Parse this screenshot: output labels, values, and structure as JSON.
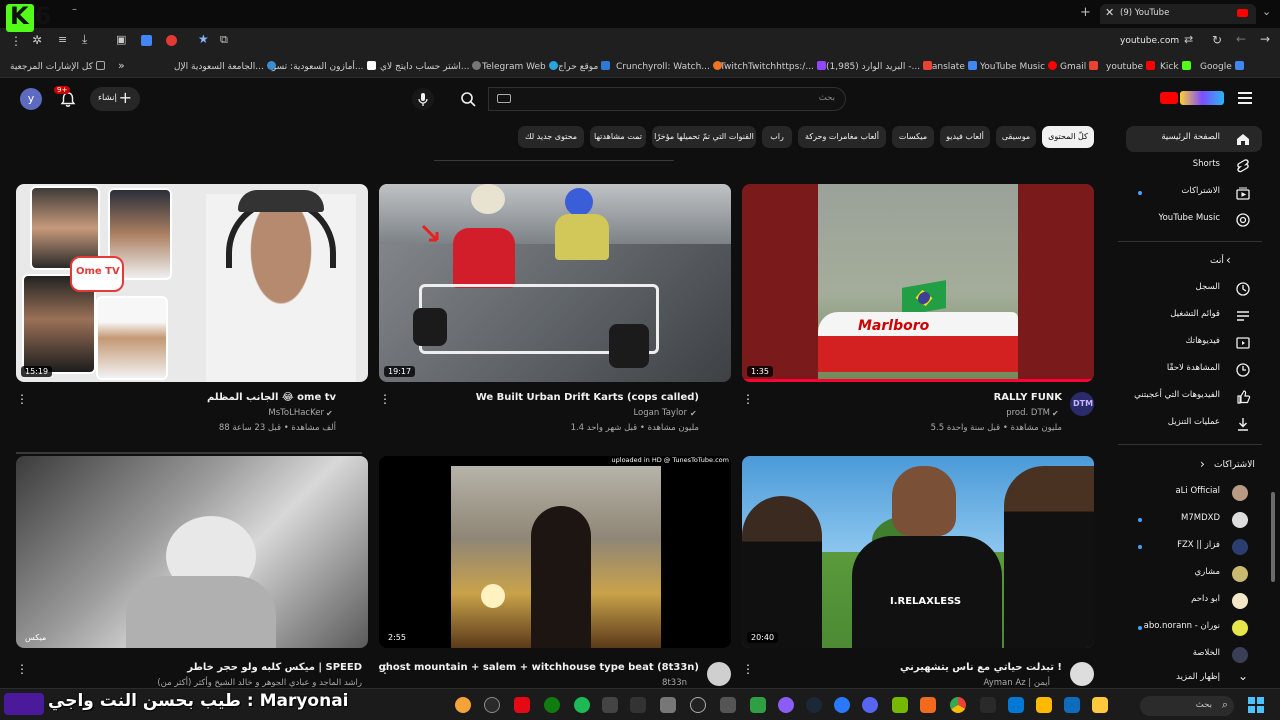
{
  "tabs": [
    {
      "label": "(9) YouTube"
    }
  ],
  "address": {
    "url": "youtube.com"
  },
  "bookmarks": [
    {
      "label": "Google",
      "color": "#4285f4"
    },
    {
      "label": "Kick",
      "color": "#53fc18"
    },
    {
      "label": "youtube",
      "color": "#ff0000"
    },
    {
      "label": "Gmail",
      "color": "#ea4335"
    },
    {
      "label": "YouTube Music",
      "color": "#ff0000"
    },
    {
      "label": "Translate",
      "color": "#4285f4"
    },
    {
      "label": "البريد الوارد (1,985) -...",
      "color": "#ea4335"
    },
    {
      "label": "TwitchTwitchhttps:/...",
      "color": "#9146ff"
    },
    {
      "label": "Crunchyroll: Watch...",
      "color": "#f47521"
    },
    {
      "label": "موقع حراج",
      "color": "#2d7ad6"
    },
    {
      "label": "Telegram Web",
      "color": "#2aa3df"
    },
    {
      "label": "اشتر حساب دايتج لاي...",
      "color": "#777777"
    },
    {
      "label": "أمازون السعودية: تسو...",
      "color": "#ffffff"
    },
    {
      "label": "الجامعة السعودية الإل...",
      "color": "#3a8ed0"
    },
    {
      "label": "كل الإشارات المرجعية",
      "color": "#aaaaaa"
    }
  ],
  "header": {
    "search_placeholder": "بحث",
    "create_label": "إنشاء",
    "notif_badge": "9+",
    "avatar_letter": "y"
  },
  "chips": [
    {
      "label": "كلّ المحتوى",
      "active": true
    },
    {
      "label": "موسيقى",
      "active": false
    },
    {
      "label": "ألعاب فيديو",
      "active": false
    },
    {
      "label": "ميكسات",
      "active": false
    },
    {
      "label": "ألعاب مغامرات وحركة",
      "active": false
    },
    {
      "label": "راب",
      "active": false
    },
    {
      "label": "القنوات التي تمّ تحميلها مؤخرًا",
      "active": false
    },
    {
      "label": "تمت مشاهدتها",
      "active": false
    },
    {
      "label": "محتوى جديد لك",
      "active": false
    }
  ],
  "videos": [
    {
      "title": "RALLY FUNK",
      "channel": "prod. DTM",
      "meta": "5.5 مليون مشاهدة • قبل سنة واحدة",
      "duration": "1:35",
      "verified": true
    },
    {
      "title": "We Built Urban Drift Karts (cops called)",
      "channel": "Logan Taylor",
      "meta": "1.4 مليون مشاهدة • قبل شهر واحد",
      "duration": "19:17",
      "verified": true
    },
    {
      "title": "الجانب المظلم 😂 ome tv",
      "channel": "MsToLHacKer",
      "meta": "88 ألف مشاهدة • قبل 23 ساعة",
      "duration": "15:19",
      "verified": true
    },
    {
      "title": "تبدلت حياتي مع ناس يتشهيرني !",
      "channel": "Ayman Az | أيمن",
      "meta": "",
      "duration": "20:40",
      "verified": true
    },
    {
      "title": "ghost mountain + salem + witchhouse type beat (8t33n)",
      "channel": "8t33n",
      "meta": "",
      "duration": "2:55",
      "verified": true
    },
    {
      "title": "ميكس كلبه ولو حجر خاطر | SPEED",
      "channel": "راشد الماجد و عبادي الجوهر و خالد الشيخ وأكثر (أكثر من)",
      "meta": "",
      "duration": "ميكس",
      "verified": false
    }
  ],
  "video2_overlay": "uploaded in HD @ TunesToTube.com",
  "thumb1_text": "Marlboro",
  "thumb3_badge": "Ome TV",
  "thumb6_badge": "I.RELAXLESS",
  "sidebar": {
    "main": [
      {
        "label": "الصفحة الرئيسية",
        "icon": "home-icon"
      },
      {
        "label": "Shorts",
        "icon": "shorts-icon"
      },
      {
        "label": "الاشتراكات",
        "icon": "subscriptions-icon"
      },
      {
        "label": "YouTube Music",
        "icon": "music-icon"
      }
    ],
    "you_header": "أنت",
    "you": [
      {
        "label": "السجل",
        "icon": "history-icon"
      },
      {
        "label": "قوائم التشغيل",
        "icon": "playlist-icon"
      },
      {
        "label": "فيديوهاتك",
        "icon": "your-videos-icon"
      },
      {
        "label": "المشاهدة لاحقًا",
        "icon": "clock-icon"
      },
      {
        "label": "الفيديوهات التي أعجبتني",
        "icon": "like-icon"
      },
      {
        "label": "عمليات التنزيل",
        "icon": "download-icon"
      }
    ],
    "subs_header": "الاشتراكات",
    "subs": [
      {
        "label": "aLi Official",
        "dot": false
      },
      {
        "label": "M7MDXD",
        "dot": true
      },
      {
        "label": "FZX || فزاز",
        "dot": true
      },
      {
        "label": "مشاري",
        "dot": false
      },
      {
        "label": "ابو داحم",
        "dot": false
      },
      {
        "label": "abo.norann - نوران",
        "dot": true
      },
      {
        "label": "الخلاصة",
        "dot": false
      },
      {
        "label": "إظهار المزيد",
        "dot": false
      }
    ]
  },
  "taskbar": {
    "search_label": "بحث"
  },
  "overlay_stream_text": "طيب بحسن النت واجي : Maryonai",
  "overlay_logo": "K6"
}
